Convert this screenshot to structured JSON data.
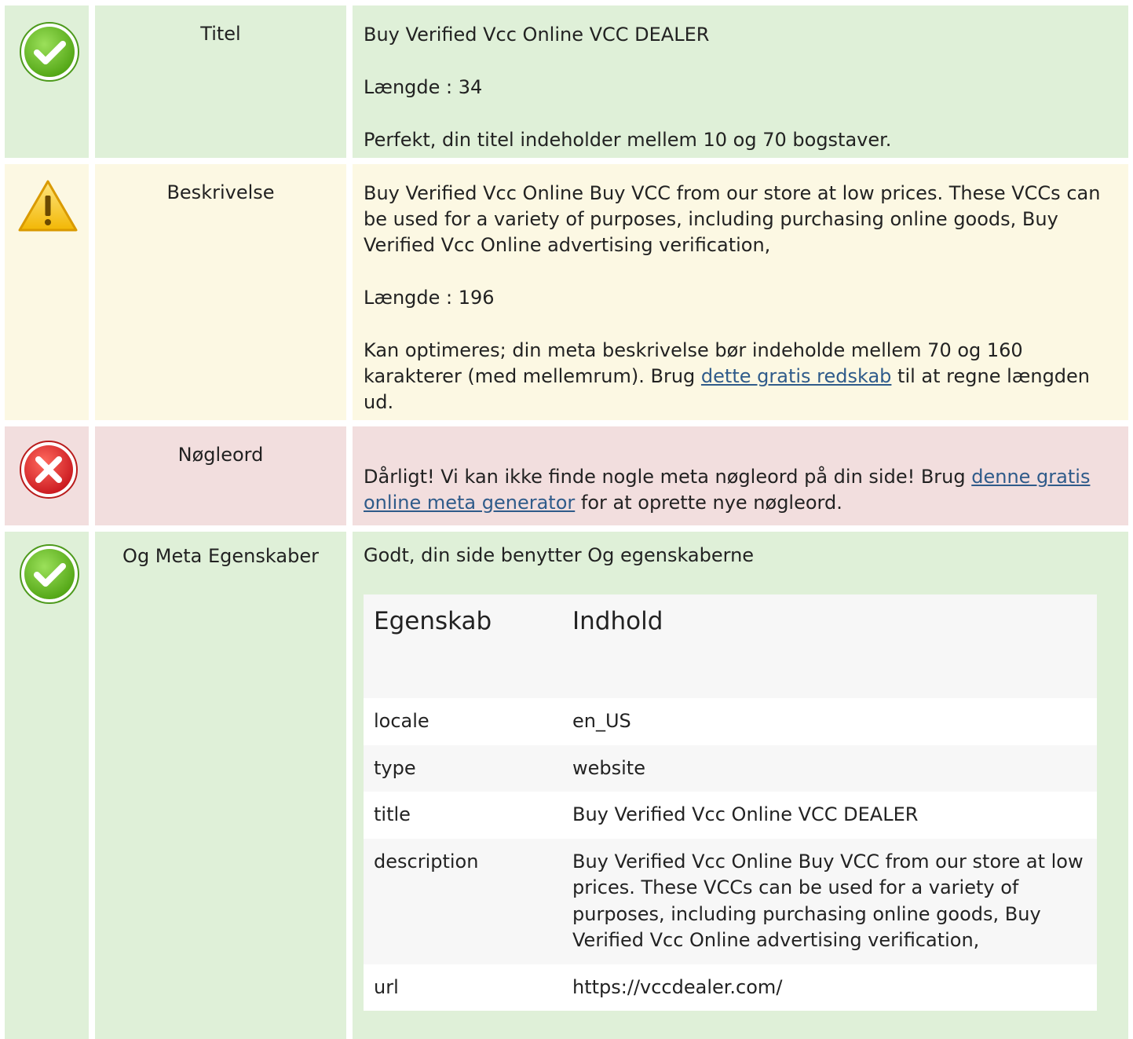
{
  "rows": [
    {
      "status": "ok",
      "status_icon": "check-icon",
      "label": "Titel",
      "value": "Buy Verified Vcc Online VCC DEALER",
      "length": "Længde : 34",
      "message": "Perfekt, din titel indeholder mellem 10 og 70 bogstaver."
    },
    {
      "status": "warn",
      "status_icon": "warning-icon",
      "label": "Beskrivelse",
      "value": "Buy Verified Vcc Online Buy VCC from our store at low prices. These VCCs can be used for a variety of purposes, including purchasing online goods, Buy Verified Vcc Online advertising verification,",
      "length": "Længde : 196",
      "message_before": "Kan optimeres; din meta beskrivelse bør indeholde mellem 70 og 160 karakterer (med mellemrum). Brug ",
      "message_link": "dette gratis redskab",
      "message_after": " til at regne længden ud."
    },
    {
      "status": "bad",
      "status_icon": "error-icon",
      "label": "Nøgleord",
      "message_before": "Dårligt! Vi kan ikke finde nogle meta nøgleord på din side! Brug ",
      "message_link": "denne gratis online meta generator",
      "message_after": " for at oprette nye nøgleord."
    },
    {
      "status": "ok",
      "status_icon": "check-icon",
      "label": "Og Meta Egenskaber",
      "message": "Godt, din side benytter Og egenskaberne",
      "table": {
        "headers": [
          "Egenskab",
          "Indhold"
        ],
        "rows": [
          [
            "locale",
            "en_US"
          ],
          [
            "type",
            "website"
          ],
          [
            "title",
            "Buy Verified Vcc Online VCC DEALER"
          ],
          [
            "description",
            "Buy Verified Vcc Online Buy VCC from our store at low prices. These VCCs can be used for a variety of purposes, including purchasing online goods, Buy Verified Vcc Online advertising verification,"
          ],
          [
            "url",
            "https://vccdealer.com/"
          ]
        ]
      }
    }
  ],
  "colors": {
    "ok_bg": "#dff0d8",
    "warn_bg": "#fcf8e3",
    "bad_bg": "#f2dede",
    "ok_icon": "#6fbf2a",
    "warn_icon": "#f5c518",
    "bad_icon": "#e0302b",
    "link": "#2f5b8a"
  }
}
